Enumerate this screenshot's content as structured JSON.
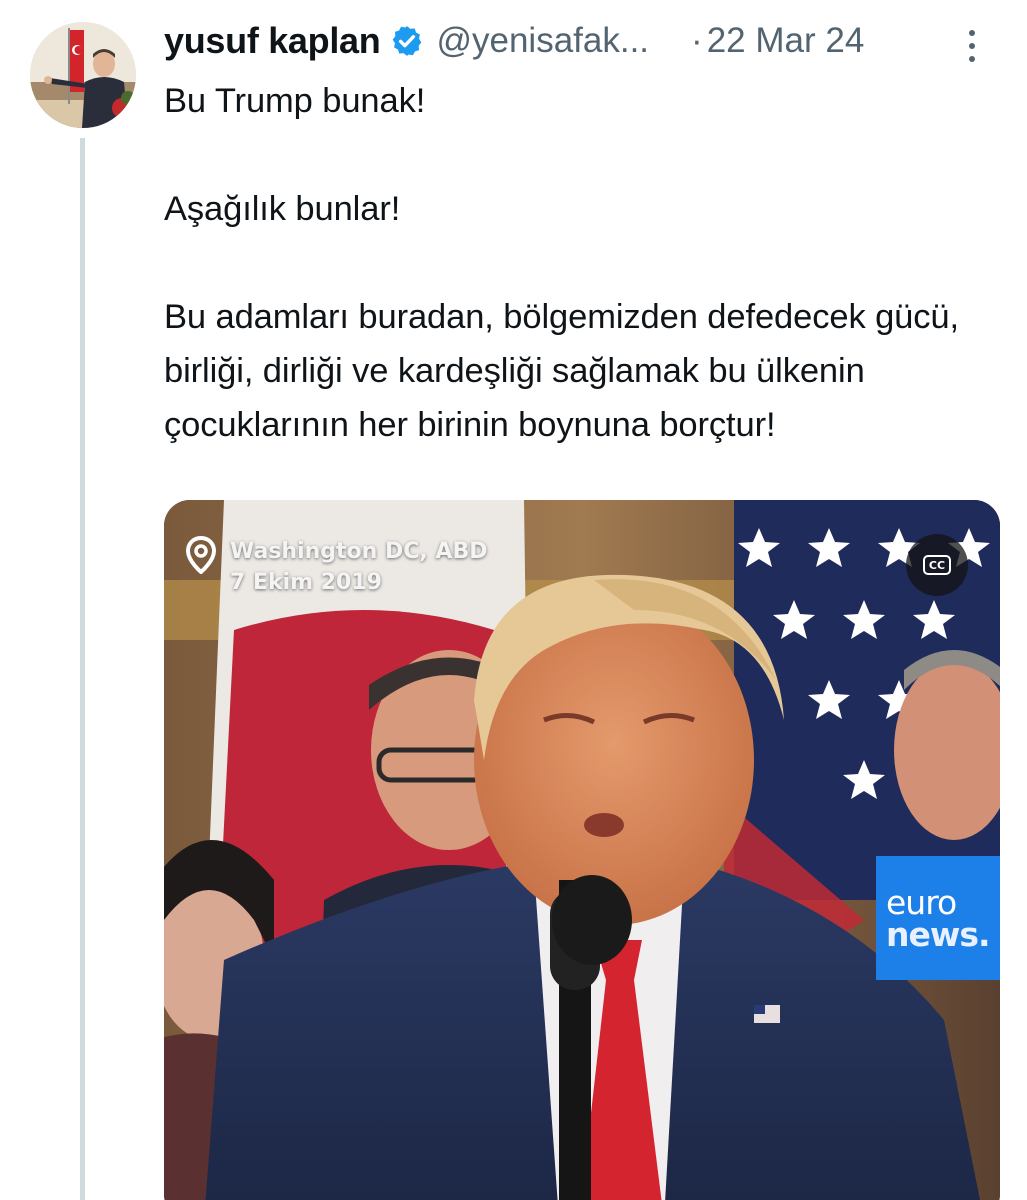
{
  "author": {
    "display_name": "yusuf kaplan",
    "handle": "@yenisafak...",
    "separator": "·",
    "date": "22 Mar 24",
    "verified_icon": "verified-badge-icon",
    "avatar": "profile-photo"
  },
  "tweet": {
    "paragraphs": [
      "Bu Trump bunak!",
      "Aşağılık bunlar!",
      "Bu adamları buradan, bölgemizden defedecek gücü, birliği, dirliği ve kardeşliği sağlamak bu ülkenin çocuklarının her birinin boynuna borçtur!"
    ]
  },
  "media": {
    "location_line1": "Washington DC, ABD",
    "location_line2": "7 Ekim 2019",
    "cc_label": "CC",
    "logo_line1": "euro",
    "logo_line2": "news.",
    "logo_color": "#1d7fe8"
  },
  "colors": {
    "text": "#0f1419",
    "secondary": "#536471",
    "verified": "#1d9bf0",
    "thread_line": "#cfd9de"
  }
}
